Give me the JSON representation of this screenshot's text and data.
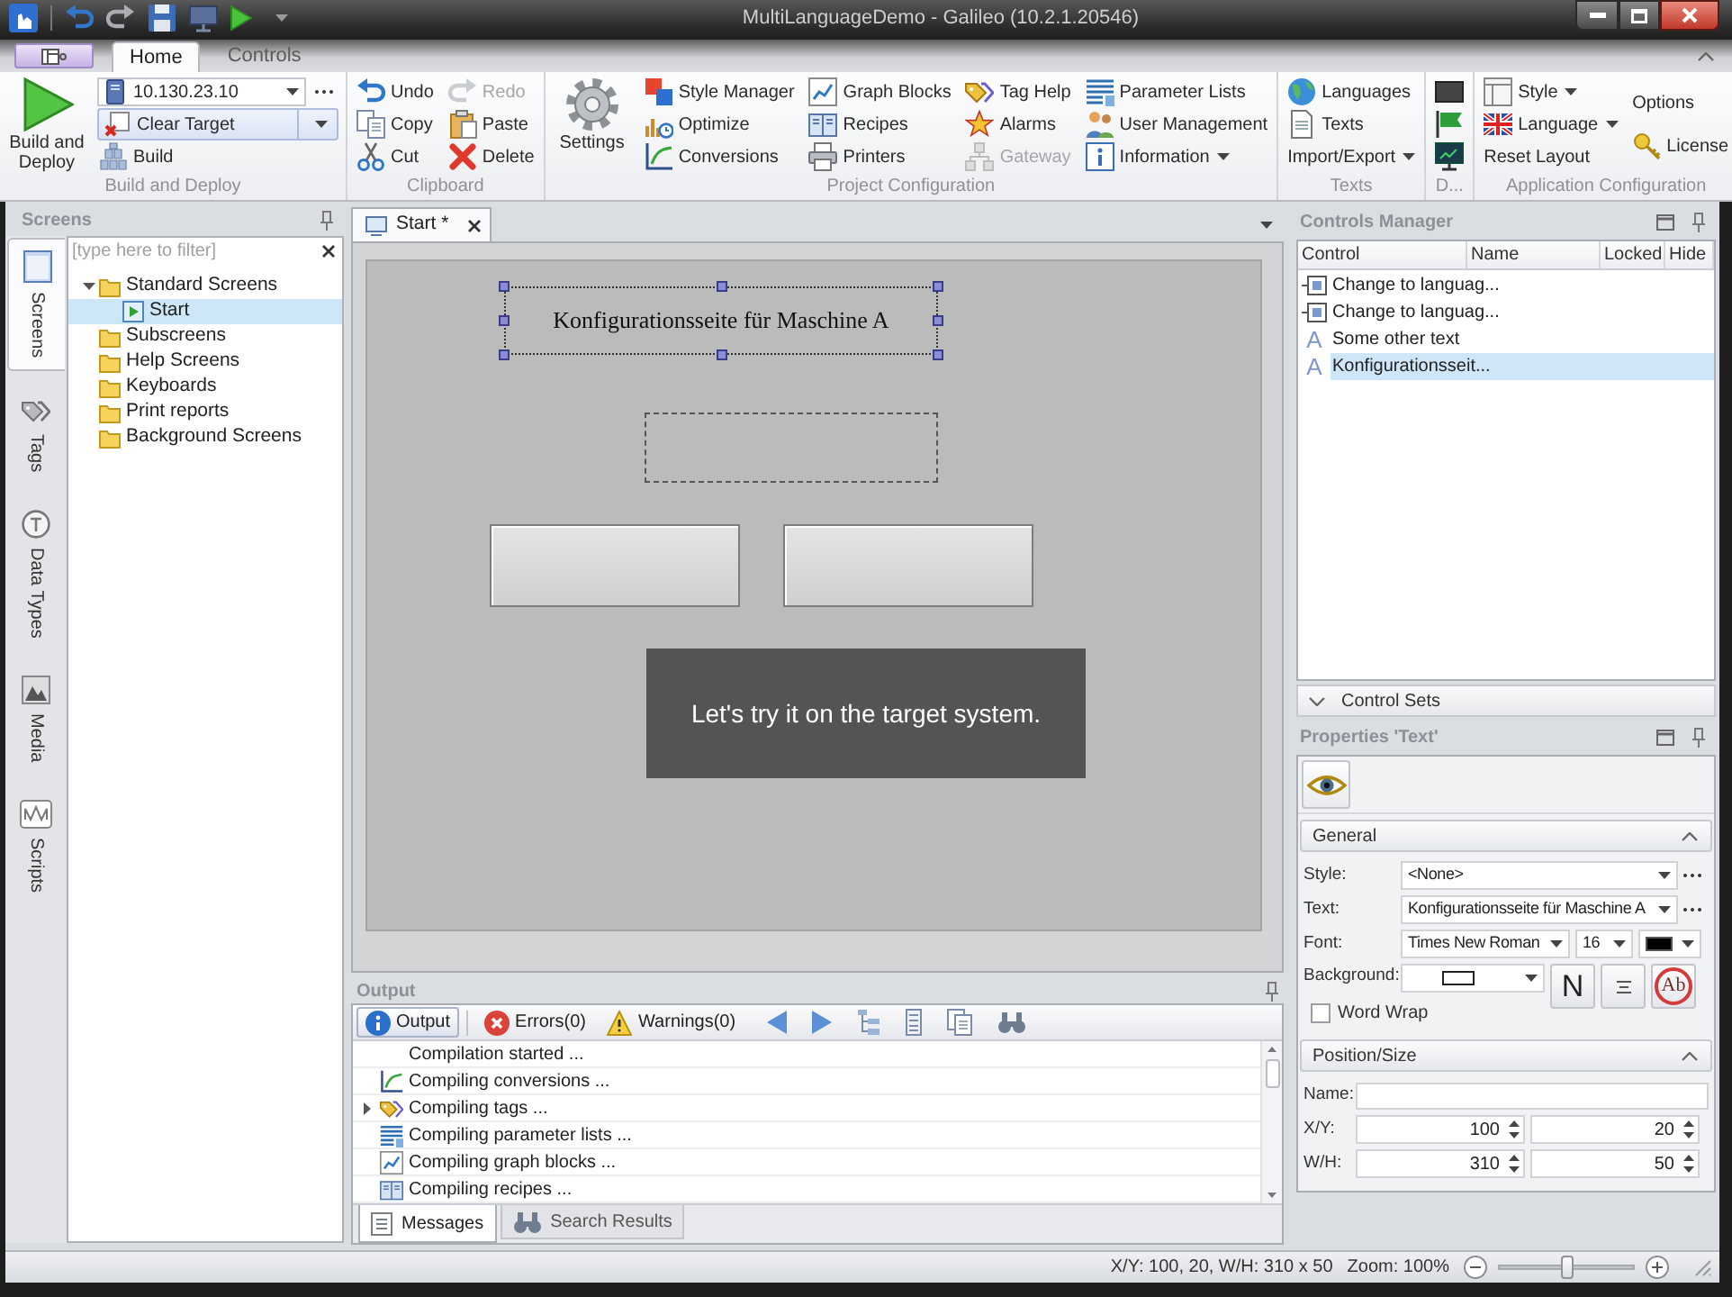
{
  "window": {
    "title": "MultiLanguageDemo - Galileo (10.2.1.20546)"
  },
  "ribbon": {
    "tabs": [
      {
        "label": "Home",
        "selected": true
      },
      {
        "label": "Controls",
        "selected": false
      }
    ],
    "groups": [
      {
        "label": "Build and Deploy",
        "large": "Build and Deploy",
        "columns": [
          [
            {
              "kind": "combo",
              "value": "10.130.23.10"
            },
            {
              "kind": "split",
              "label": "Clear Target"
            },
            {
              "kind": "button",
              "label": "Build"
            }
          ]
        ]
      },
      {
        "label": "Clipboard",
        "columns": [
          [
            {
              "kind": "button",
              "label": "Undo"
            },
            {
              "kind": "button",
              "label": "Copy"
            },
            {
              "kind": "button",
              "label": "Cut"
            }
          ],
          [
            {
              "kind": "button",
              "label": "Redo",
              "disabled": true
            },
            {
              "kind": "button",
              "label": "Paste",
              "disabled": false
            },
            {
              "kind": "button",
              "label": "Delete",
              "disabled": false
            }
          ]
        ]
      },
      {
        "label": "Project Configuration",
        "large": "Settings",
        "columns": [
          [
            {
              "kind": "button",
              "label": "Style Manager"
            },
            {
              "kind": "button",
              "label": "Optimize"
            },
            {
              "kind": "button",
              "label": "Conversions"
            }
          ],
          [
            {
              "kind": "button",
              "label": "Graph Blocks"
            },
            {
              "kind": "button",
              "label": "Recipes"
            },
            {
              "kind": "button",
              "label": "Printers"
            }
          ],
          [
            {
              "kind": "button",
              "label": "Tag Help",
              "disabled": false
            },
            {
              "kind": "button",
              "label": "Alarms",
              "disabled": false
            },
            {
              "kind": "button",
              "label": "Gateway",
              "disabled": true
            }
          ],
          [
            {
              "kind": "button",
              "label": "Parameter Lists",
              "dropdown": false
            },
            {
              "kind": "button",
              "label": "User Management",
              "dropdown": false
            },
            {
              "kind": "button",
              "label": "Information",
              "dropdown": true
            }
          ]
        ]
      },
      {
        "label": "Texts",
        "columns": [
          [
            {
              "kind": "button",
              "label": "Languages",
              "dropdown": false
            },
            {
              "kind": "button",
              "label": "Texts",
              "dropdown": false
            },
            {
              "kind": "button",
              "label": "Import/Export",
              "dropdown": true
            }
          ]
        ]
      },
      {
        "label": "D...",
        "columns": [
          [
            {
              "kind": "button"
            },
            {
              "kind": "button"
            },
            {
              "kind": "button"
            }
          ]
        ]
      },
      {
        "label": "Application Configuration",
        "columns": [
          [
            {
              "kind": "button",
              "label": "Style",
              "dropdown": true
            },
            {
              "kind": "button",
              "label": "Language",
              "dropdown": true
            },
            {
              "kind": "button",
              "label": "Reset Layout",
              "dropdown": false
            }
          ],
          [
            {
              "kind": "button",
              "label": "Options"
            },
            {
              "kind": "button",
              "label": "License"
            }
          ]
        ]
      }
    ]
  },
  "screens_panel": {
    "title": "Screens",
    "filter": {
      "placeholder": "[type here to filter]"
    },
    "tree": [
      {
        "label": "Standard Screens",
        "expanded": true,
        "selected": false,
        "children": [
          {
            "label": "Start",
            "selected": true
          }
        ]
      },
      {
        "label": "Subscreens",
        "expanded": false,
        "selected": false
      },
      {
        "label": "Help Screens",
        "expanded": false,
        "selected": false
      },
      {
        "label": "Keyboards",
        "expanded": false,
        "selected": false
      },
      {
        "label": "Print reports",
        "expanded": false,
        "selected": false
      },
      {
        "label": "Background Screens",
        "expanded": false,
        "selected": false
      }
    ]
  },
  "side_tabs": [
    {
      "label": "Screens",
      "selected": true
    },
    {
      "label": "Tags",
      "selected": false
    },
    {
      "label": "Data Types",
      "selected": false
    },
    {
      "label": "Media",
      "selected": false
    },
    {
      "label": "Scripts",
      "selected": false
    }
  ],
  "document_tabs": [
    {
      "label": "Start *",
      "selected": true
    }
  ],
  "design_surface": {
    "elements": [
      {
        "kind": "label",
        "text": "Konfigurationsseite für Maschine A",
        "selected": true
      },
      {
        "kind": "label",
        "selected": false
      },
      {
        "kind": "button",
        "selected": false
      },
      {
        "kind": "button",
        "selected": false
      }
    ]
  },
  "caption": {
    "text": "Let's try it on the target system."
  },
  "output": {
    "title": "Output",
    "filters": [
      {
        "label": "Output",
        "selected": true
      },
      {
        "label": "Errors(0)",
        "selected": false
      },
      {
        "label": "Warnings(0)",
        "selected": false
      }
    ],
    "messages": [
      {
        "text": "Compilation started ...",
        "expandable": false
      },
      {
        "text": "Compiling conversions ...",
        "expandable": false
      },
      {
        "text": "Compiling tags ...",
        "expandable": true
      },
      {
        "text": "Compiling parameter lists ...",
        "expandable": false
      },
      {
        "text": "Compiling graph blocks ...",
        "expandable": false
      },
      {
        "text": "Compiling recipes ...",
        "expandable": false
      }
    ],
    "tabs": [
      {
        "label": "Messages",
        "selected": true
      },
      {
        "label": "Search Results",
        "selected": false
      }
    ]
  },
  "controls_manager": {
    "title": "Controls Manager",
    "columns": [
      "Control",
      "Name",
      "Locked",
      "Hide"
    ],
    "rows": [
      {
        "kind": "button",
        "control": "Change to languag...",
        "selected": false
      },
      {
        "kind": "button",
        "control": "Change to languag...",
        "selected": false
      },
      {
        "kind": "text",
        "icon": "A",
        "control": "Some other text",
        "selected": false
      },
      {
        "kind": "text",
        "icon": "A",
        "control": "Konfigurationsseit...",
        "selected": true
      }
    ],
    "control_sets": {
      "label": "Control Sets",
      "expanded": false
    }
  },
  "properties": {
    "title": "Properties 'Text'",
    "sections": [
      {
        "title": "General",
        "expanded": true,
        "rows": [
          {
            "kind": "combo",
            "label": "Style:",
            "value": "<None>"
          },
          {
            "kind": "combo",
            "label": "Text:",
            "value": "Konfigurationsseite für Maschine A"
          },
          {
            "kind": "font",
            "label": "Font:",
            "family": "Times New Roman",
            "size": "16",
            "color": "#000000"
          },
          {
            "kind": "background",
            "label": "Background:",
            "color": "#ffffff",
            "style_button": "N",
            "effect_button": "Ab"
          },
          {
            "kind": "checkbox",
            "label": "Word Wrap",
            "checked": false
          }
        ]
      },
      {
        "title": "Position/Size",
        "expanded": true,
        "rows": [
          {
            "kind": "text",
            "label": "Name:"
          },
          {
            "kind": "pair",
            "label": "X/Y:",
            "values": [
              "100",
              "20"
            ]
          },
          {
            "kind": "pair",
            "label": "W/H:",
            "values": [
              "310",
              "50"
            ]
          }
        ]
      }
    ]
  },
  "status_bar": {
    "position": "X/Y: 100, 20, W/H: 310 x 50",
    "zoom": {
      "label": "Zoom: 100%",
      "level": 0.5
    }
  }
}
